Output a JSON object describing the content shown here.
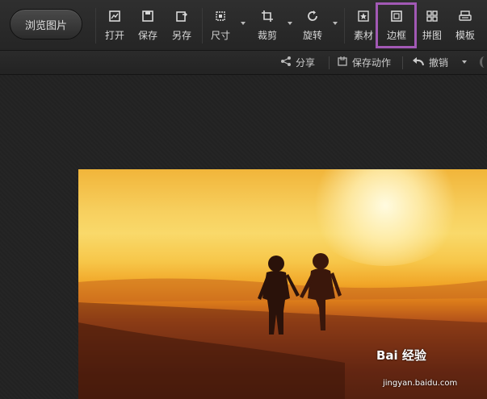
{
  "toolbar": {
    "browse_label": "浏览图片",
    "tools": [
      {
        "label": "打开",
        "icon": "open-icon"
      },
      {
        "label": "保存",
        "icon": "save-icon"
      },
      {
        "label": "另存",
        "icon": "save-as-icon"
      },
      {
        "label": "尺寸",
        "icon": "resize-icon"
      },
      {
        "label": "裁剪",
        "icon": "crop-icon"
      },
      {
        "label": "旋转",
        "icon": "rotate-icon"
      },
      {
        "label": "素材",
        "icon": "material-icon"
      },
      {
        "label": "边框",
        "icon": "border-icon"
      },
      {
        "label": "拼图",
        "icon": "collage-icon"
      },
      {
        "label": "模板",
        "icon": "template-icon"
      }
    ]
  },
  "subbar": {
    "share_label": "分享",
    "save_action_label": "保存动作",
    "undo_label": "撤销"
  },
  "watermark": {
    "brand": "Bai  经验",
    "url": "jingyan.baidu.com"
  },
  "colors": {
    "highlight": "#a259b5"
  }
}
